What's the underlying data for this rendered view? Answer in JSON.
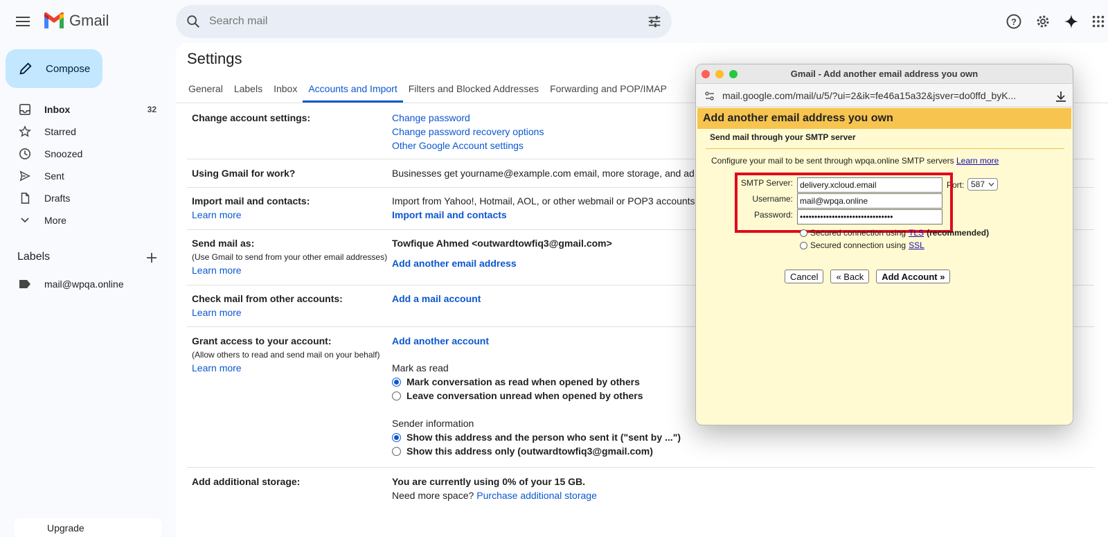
{
  "app": {
    "name": "Gmail"
  },
  "search": {
    "placeholder": "Search mail"
  },
  "sidebar": {
    "compose": "Compose",
    "items": [
      {
        "label": "Inbox",
        "count": "32",
        "icon": "inbox-icon"
      },
      {
        "label": "Starred",
        "count": "",
        "icon": "star-icon"
      },
      {
        "label": "Snoozed",
        "count": "",
        "icon": "clock-icon"
      },
      {
        "label": "Sent",
        "count": "",
        "icon": "send-icon"
      },
      {
        "label": "Drafts",
        "count": "",
        "icon": "draft-icon"
      },
      {
        "label": "More",
        "count": "",
        "icon": "chevron-down-icon"
      }
    ],
    "labels_heading": "Labels",
    "labels": [
      {
        "label": "mail@wpqa.online"
      }
    ],
    "upgrade": "Upgrade"
  },
  "settings": {
    "title": "Settings",
    "tabs": [
      "General",
      "Labels",
      "Inbox",
      "Accounts and Import",
      "Filters and Blocked Addresses",
      "Forwarding and POP/IMAP"
    ],
    "active_tab": "Accounts and Import",
    "change_account": {
      "label": "Change account settings:",
      "links": [
        "Change password",
        "Change password recovery options",
        "Other Google Account settings"
      ]
    },
    "gmail_work": {
      "label": "Using Gmail for work?",
      "text": "Businesses get yourname@example.com email, more storage, and ad"
    },
    "import": {
      "label": "Import mail and contacts:",
      "learn_more": "Learn more",
      "text": "Import from Yahoo!, Hotmail, AOL, or other webmail or POP3 accounts",
      "action": "Import mail and contacts"
    },
    "send_as": {
      "label": "Send mail as:",
      "sub": "(Use Gmail to send from your other email addresses)",
      "learn_more": "Learn more",
      "identity": "Towfique Ahmed <outwardtowfiq3@gmail.com>",
      "action": "Add another email address"
    },
    "check_mail": {
      "label": "Check mail from other accounts:",
      "learn_more": "Learn more",
      "action": "Add a mail account"
    },
    "grant_access": {
      "label": "Grant access to your account:",
      "sub": "(Allow others to read and send mail on your behalf)",
      "learn_more": "Learn more",
      "action": "Add another account",
      "mark_read_heading": "Mark as read",
      "mark_read_options": [
        "Mark conversation as read when opened by others",
        "Leave conversation unread when opened by others"
      ],
      "sender_heading": "Sender information",
      "sender_options": [
        "Show this address and the person who sent it (\"sent by ...\")",
        "Show this address only (outwardtowfiq3@gmail.com)"
      ]
    },
    "storage": {
      "label": "Add additional storage:",
      "usage": "You are currently using 0% of your 15 GB.",
      "need_more": "Need more space?",
      "action": "Purchase additional storage"
    }
  },
  "popup": {
    "window_title": "Gmail - Add another email address you own",
    "url": "mail.google.com/mail/u/5/?ui=2&ik=fe46a15a32&jsver=do0ffd_byK...",
    "header": "Add another email address you own",
    "subheader": "Send mail through your SMTP server",
    "description": "Configure your mail to be sent through wpqa.online SMTP servers",
    "learn_more": "Learn more",
    "smtp_label": "SMTP Server:",
    "smtp_value": "delivery.xcloud.email",
    "port_label": "Port:",
    "port_value": "587",
    "username_label": "Username:",
    "username_value": "mail@wpqa.online",
    "password_label": "Password:",
    "password_value": "••••••••••••••••••••••••••••••••",
    "tls_text": "Secured connection using",
    "tls_link": "TLS",
    "tls_suffix": "(recommended)",
    "ssl_text": "Secured connection using",
    "ssl_link": "SSL",
    "cancel": "Cancel",
    "back": "« Back",
    "add_account": "Add Account »"
  },
  "colors": {
    "accent": "#0b57d0",
    "compose_bg": "#c2e7ff",
    "popup_header": "#f6c44f",
    "highlight": "#e00a1e"
  }
}
